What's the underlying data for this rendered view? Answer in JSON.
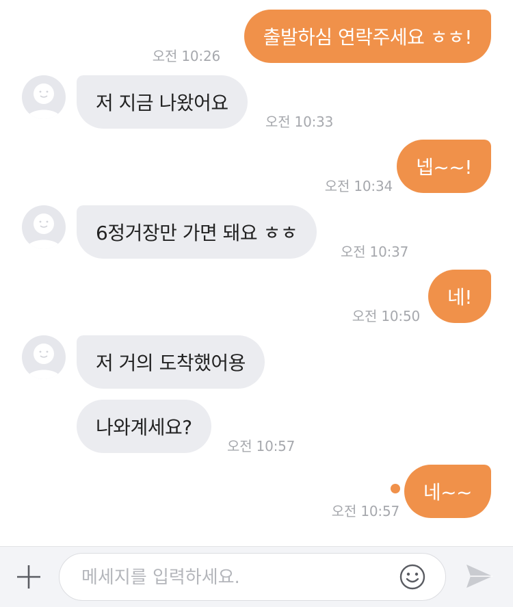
{
  "messages": [
    {
      "id": "m1",
      "sender": "me",
      "text": "출발하심 연락주세요 ㅎㅎ!",
      "time": "오전 10:26"
    },
    {
      "id": "m2",
      "sender": "other",
      "text": "저 지금 나왔어요",
      "time": "오전 10:33"
    },
    {
      "id": "m3",
      "sender": "me",
      "text": "넵~~!",
      "time": "오전 10:34"
    },
    {
      "id": "m4",
      "sender": "other",
      "text": "6정거장만 가면 돼요 ㅎㅎ",
      "time": "오전 10:37"
    },
    {
      "id": "m5",
      "sender": "me",
      "text": "네!",
      "time": "오전 10:50"
    },
    {
      "id": "m6",
      "sender": "other",
      "text": "저 거의 도착했어용",
      "time": ""
    },
    {
      "id": "m7",
      "sender": "other",
      "text": "나와계세요?",
      "time": "오전 10:57"
    },
    {
      "id": "m8",
      "sender": "me",
      "text": "네~~",
      "time": "오전 10:57",
      "unread": true
    }
  ],
  "composer": {
    "placeholder": "메세지를 입력하세요.",
    "plus_icon": "plus-icon",
    "emoji_icon": "smiley-icon",
    "send_icon": "send-icon"
  },
  "colors": {
    "outgoing_bubble": "#f0914a",
    "incoming_bubble": "#ebecf0",
    "timestamp": "#a6a8ad",
    "unread_dot": "#f0914a"
  }
}
